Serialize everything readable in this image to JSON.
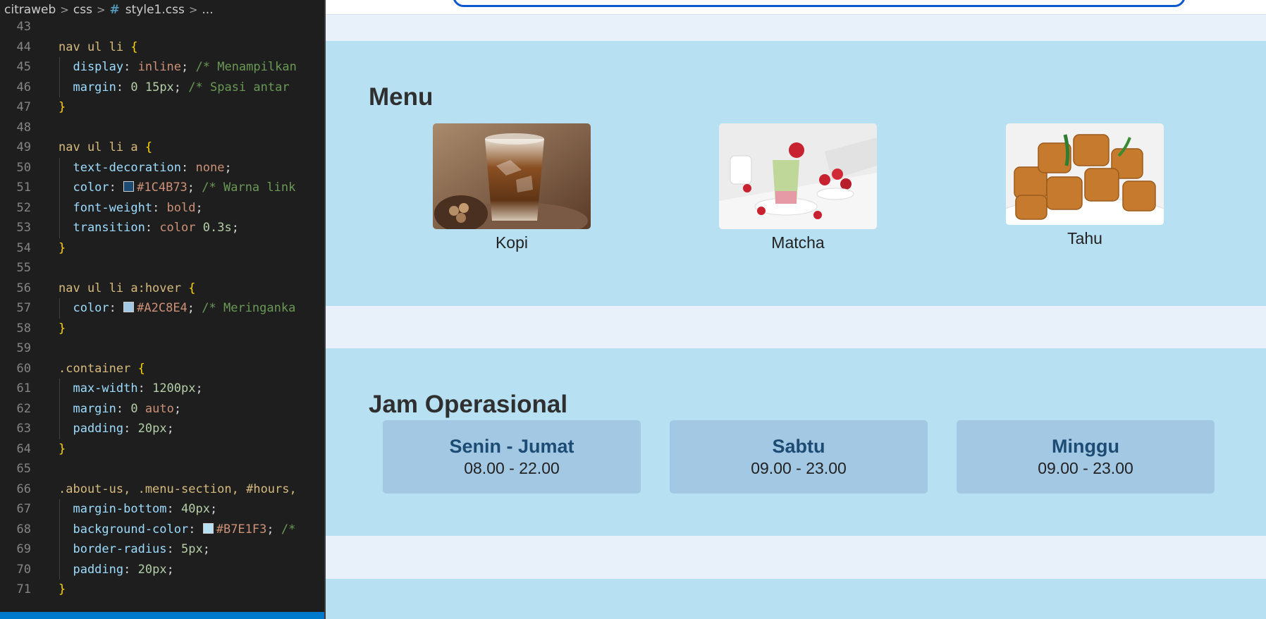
{
  "editor": {
    "breadcrumb": {
      "folder": "citraweb",
      "subfolder": "css",
      "file": "style1.css",
      "more": "..."
    },
    "lines": [
      {
        "n": "43",
        "segs": []
      },
      {
        "n": "44",
        "segs": [
          {
            "c": "sel",
            "t": "nav ul li "
          },
          {
            "c": "brace",
            "t": "{"
          }
        ]
      },
      {
        "n": "45",
        "segs": [
          {
            "c": "prop",
            "t": "  display"
          },
          {
            "c": "",
            "t": ": "
          },
          {
            "c": "val",
            "t": "inline"
          },
          {
            "c": "",
            "t": "; "
          },
          {
            "c": "cmt",
            "t": "/* Menampilkan"
          }
        ]
      },
      {
        "n": "46",
        "segs": [
          {
            "c": "prop",
            "t": "  margin"
          },
          {
            "c": "",
            "t": ": "
          },
          {
            "c": "num",
            "t": "0 15px"
          },
          {
            "c": "",
            "t": "; "
          },
          {
            "c": "cmt",
            "t": "/* Spasi antar"
          }
        ]
      },
      {
        "n": "47",
        "segs": [
          {
            "c": "brace",
            "t": "}"
          }
        ]
      },
      {
        "n": "48",
        "segs": []
      },
      {
        "n": "49",
        "segs": [
          {
            "c": "sel",
            "t": "nav ul li a "
          },
          {
            "c": "brace",
            "t": "{"
          }
        ]
      },
      {
        "n": "50",
        "segs": [
          {
            "c": "prop",
            "t": "  text-decoration"
          },
          {
            "c": "",
            "t": ": "
          },
          {
            "c": "val",
            "t": "none"
          },
          {
            "c": "",
            "t": ";"
          }
        ]
      },
      {
        "n": "51",
        "segs": [
          {
            "c": "prop",
            "t": "  color"
          },
          {
            "c": "",
            "t": ": "
          },
          {
            "c": "swatch",
            "t": "#1C4B73"
          },
          {
            "c": "val",
            "t": "#1C4B73"
          },
          {
            "c": "",
            "t": "; "
          },
          {
            "c": "cmt",
            "t": "/* Warna link"
          }
        ]
      },
      {
        "n": "52",
        "segs": [
          {
            "c": "prop",
            "t": "  font-weight"
          },
          {
            "c": "",
            "t": ": "
          },
          {
            "c": "val",
            "t": "bold"
          },
          {
            "c": "",
            "t": ";"
          }
        ]
      },
      {
        "n": "53",
        "segs": [
          {
            "c": "prop",
            "t": "  transition"
          },
          {
            "c": "",
            "t": ": "
          },
          {
            "c": "val",
            "t": "color "
          },
          {
            "c": "num",
            "t": "0.3s"
          },
          {
            "c": "",
            "t": ";"
          }
        ]
      },
      {
        "n": "54",
        "segs": [
          {
            "c": "brace",
            "t": "}"
          }
        ]
      },
      {
        "n": "55",
        "segs": []
      },
      {
        "n": "56",
        "segs": [
          {
            "c": "sel",
            "t": "nav ul li a:hover "
          },
          {
            "c": "brace",
            "t": "{"
          }
        ]
      },
      {
        "n": "57",
        "segs": [
          {
            "c": "prop",
            "t": "  color"
          },
          {
            "c": "",
            "t": ": "
          },
          {
            "c": "swatch",
            "t": "#A2C8E4"
          },
          {
            "c": "val",
            "t": "#A2C8E4"
          },
          {
            "c": "",
            "t": "; "
          },
          {
            "c": "cmt",
            "t": "/* Meringanka"
          }
        ]
      },
      {
        "n": "58",
        "segs": [
          {
            "c": "brace",
            "t": "}"
          }
        ]
      },
      {
        "n": "59",
        "segs": []
      },
      {
        "n": "60",
        "segs": [
          {
            "c": "sel",
            "t": ".container "
          },
          {
            "c": "brace",
            "t": "{"
          }
        ]
      },
      {
        "n": "61",
        "segs": [
          {
            "c": "prop",
            "t": "  max-width"
          },
          {
            "c": "",
            "t": ": "
          },
          {
            "c": "num",
            "t": "1200px"
          },
          {
            "c": "",
            "t": ";"
          }
        ]
      },
      {
        "n": "62",
        "segs": [
          {
            "c": "prop",
            "t": "  margin"
          },
          {
            "c": "",
            "t": ": "
          },
          {
            "c": "num",
            "t": "0 "
          },
          {
            "c": "val",
            "t": "auto"
          },
          {
            "c": "",
            "t": ";"
          }
        ]
      },
      {
        "n": "63",
        "segs": [
          {
            "c": "prop",
            "t": "  padding"
          },
          {
            "c": "",
            "t": ": "
          },
          {
            "c": "num",
            "t": "20px"
          },
          {
            "c": "",
            "t": ";"
          }
        ]
      },
      {
        "n": "64",
        "segs": [
          {
            "c": "brace",
            "t": "}"
          }
        ]
      },
      {
        "n": "65",
        "segs": []
      },
      {
        "n": "66",
        "segs": [
          {
            "c": "sel",
            "t": ".about-us, .menu-section, #hours,"
          }
        ]
      },
      {
        "n": "67",
        "segs": [
          {
            "c": "prop",
            "t": "  margin-bottom"
          },
          {
            "c": "",
            "t": ": "
          },
          {
            "c": "num",
            "t": "40px"
          },
          {
            "c": "",
            "t": ";"
          }
        ]
      },
      {
        "n": "68",
        "segs": [
          {
            "c": "prop",
            "t": "  background-color"
          },
          {
            "c": "",
            "t": ": "
          },
          {
            "c": "swatch",
            "t": "#B7E1F3"
          },
          {
            "c": "val",
            "t": "#B7E1F3"
          },
          {
            "c": "",
            "t": "; "
          },
          {
            "c": "cmt",
            "t": "/*"
          }
        ]
      },
      {
        "n": "69",
        "segs": [
          {
            "c": "prop",
            "t": "  border-radius"
          },
          {
            "c": "",
            "t": ": "
          },
          {
            "c": "num",
            "t": "5px"
          },
          {
            "c": "",
            "t": ";"
          }
        ]
      },
      {
        "n": "70",
        "segs": [
          {
            "c": "prop",
            "t": "  padding"
          },
          {
            "c": "",
            "t": ": "
          },
          {
            "c": "num",
            "t": "20px"
          },
          {
            "c": "",
            "t": ";"
          }
        ]
      },
      {
        "n": "71",
        "segs": [
          {
            "c": "brace",
            "t": "}"
          }
        ]
      }
    ]
  },
  "page": {
    "menu": {
      "title": "Menu",
      "items": [
        {
          "label": "Kopi",
          "image": "iced-coffee"
        },
        {
          "label": "Matcha",
          "image": "matcha-drink"
        },
        {
          "label": "Tahu",
          "image": "fried-tofu"
        }
      ]
    },
    "hours": {
      "title": "Jam Operasional",
      "cards": [
        {
          "day": "Senin - Jumat",
          "time": "08.00 - 22.00"
        },
        {
          "day": "Sabtu",
          "time": "09.00 - 23.00"
        },
        {
          "day": "Minggu",
          "time": "09.00 - 23.00"
        }
      ]
    }
  },
  "colors": {
    "section_bg": "#B7E1F3",
    "card_bg": "#A2C8E4",
    "day_text": "#1C4B73",
    "page_bg": "#E8F1FA"
  }
}
